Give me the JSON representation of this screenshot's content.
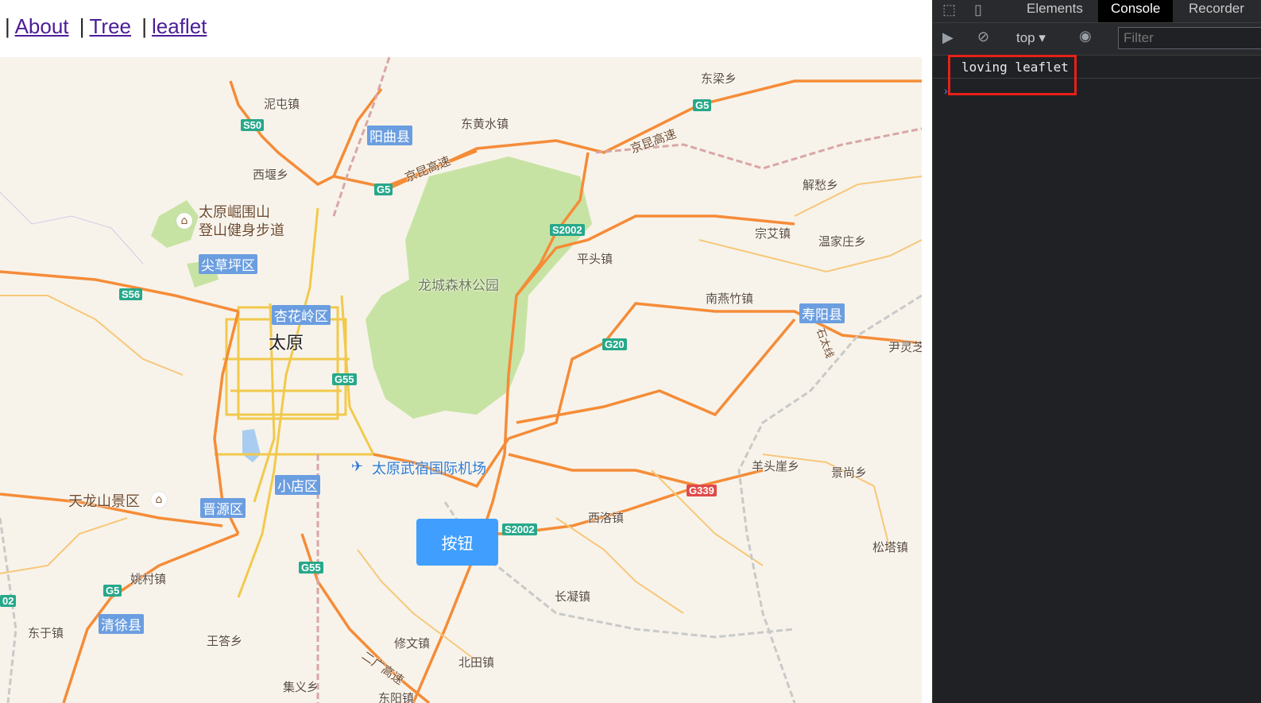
{
  "nav": {
    "leading_sep": "|",
    "links": [
      "About",
      "Tree",
      "leaflet"
    ],
    "sep": "|"
  },
  "map": {
    "button_label": "按钮",
    "city": "太原",
    "districts": [
      "阳曲县",
      "尖草坪区",
      "杏花岭区",
      "小店区",
      "晋源区",
      "清徐县",
      "寿阳县"
    ],
    "places": [
      "泥屯镇",
      "东黄水镇",
      "东梁乡",
      "西堰乡",
      "解愁乡",
      "宗艾镇",
      "温家庄乡",
      "平头镇",
      "南燕竹镇",
      "尹灵芝",
      "羊头崖乡",
      "景尚乡",
      "西洛镇",
      "松塔镇",
      "长凝镇",
      "姚村镇",
      "东于镇",
      "王答乡",
      "修文镇",
      "北田镇",
      "集义乡",
      "东阳镇"
    ],
    "park": "龙城森林公园",
    "poi_1_line1": "太原崛围山",
    "poi_1_line2": "登山健身步道",
    "poi_2": "天龙山景区",
    "airport": "太原武宿国际机场",
    "highways": {
      "jingkun_1": "京昆高速",
      "jingkun_2": "京昆高速",
      "erguang": "二广高速",
      "shitai": "石太线"
    },
    "shields": [
      "S50",
      "G5",
      "G5",
      "S2002",
      "S56",
      "G55",
      "G20",
      "G339",
      "S2002",
      "G55",
      "G5",
      "02"
    ],
    "poi_icon": "lodging-icon",
    "airport_icon": "airplane-icon"
  },
  "devtools": {
    "tabs": [
      "Elements",
      "Console",
      "Recorder"
    ],
    "active_tab": "Console",
    "context": "top",
    "filter_placeholder": "Filter",
    "log": "loving leaflet",
    "colors": {
      "highlight": "#e8201a",
      "bg": "#202124"
    }
  }
}
